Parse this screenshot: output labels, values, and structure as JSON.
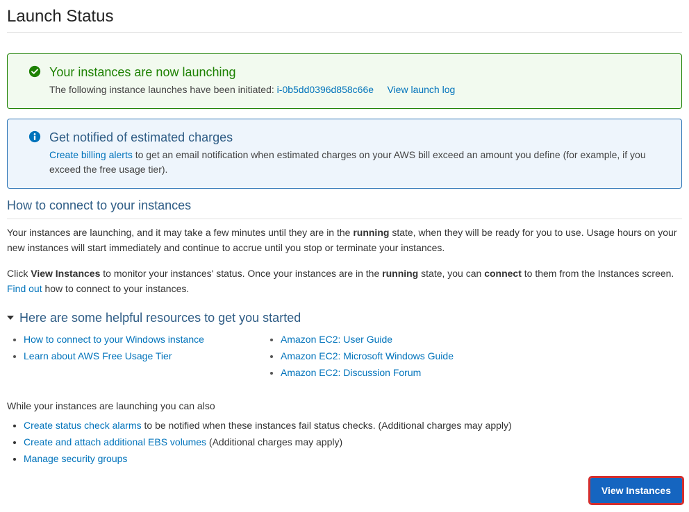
{
  "page_title": "Launch Status",
  "success_box": {
    "title": "Your instances are now launching",
    "prefix": "The following instance launches have been initiated:",
    "instance_id": "i-0b5dd0396d858c66e",
    "view_log": "View launch log"
  },
  "info_box": {
    "title": "Get notified of estimated charges",
    "link": "Create billing alerts",
    "body": " to get an email notification when estimated charges on your AWS bill exceed an amount you define (for example, if you exceed the free usage tier)."
  },
  "connect_header": "How to connect to your instances",
  "para1_a": "Your instances are launching, and it may take a few minutes until they are in the ",
  "para1_b": "running",
  "para1_c": " state, when they will be ready for you to use. Usage hours on your new instances will start immediately and continue to accrue until you stop or terminate your instances.",
  "para2_a": "Click ",
  "para2_b": "View Instances",
  "para2_c": " to monitor your instances' status. Once your instances are in the ",
  "para2_d": "running",
  "para2_e": " state, you can ",
  "para2_f": "connect",
  "para2_g": " to them from the Instances screen. ",
  "para2_link": "Find out",
  "para2_h": " how to connect to your instances.",
  "resources_header": "Here are some helpful resources to get you started",
  "col1": [
    "How to connect to your Windows instance",
    "Learn about AWS Free Usage Tier"
  ],
  "col2": [
    "Amazon EC2: User Guide",
    "Amazon EC2: Microsoft Windows Guide",
    "Amazon EC2: Discussion Forum"
  ],
  "also_header": "While your instances are launching you can also",
  "also": [
    {
      "link": "Create status check alarms",
      "rest": " to be notified when these instances fail status checks. (Additional charges may apply)"
    },
    {
      "link": "Create and attach additional EBS volumes",
      "rest": " (Additional charges may apply)"
    },
    {
      "link": "Manage security groups",
      "rest": ""
    }
  ],
  "view_button": "View Instances"
}
